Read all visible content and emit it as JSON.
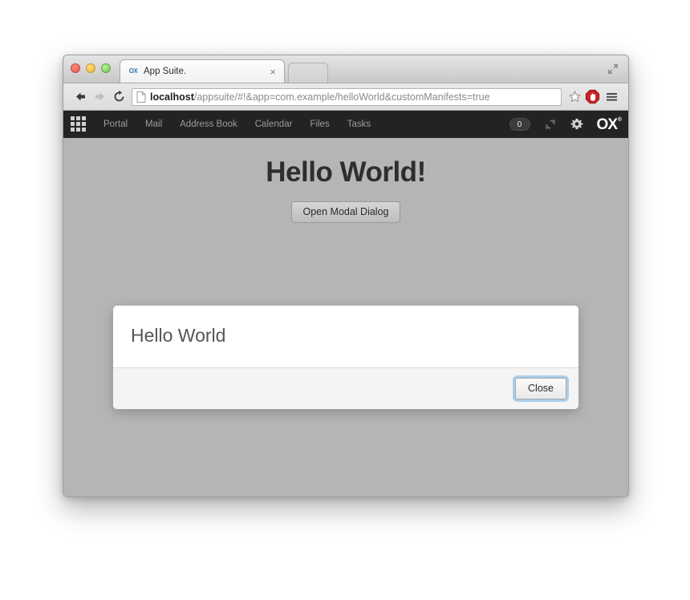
{
  "browser": {
    "traffic_lights": [
      "close",
      "minimize",
      "zoom"
    ],
    "tab": {
      "favicon_label": "OX",
      "title": "App Suite.",
      "close_label": "×"
    },
    "fullscreen_icon": "fullscreen-icon",
    "toolbar": {
      "back_icon": "back-arrow-icon",
      "forward_icon": "forward-arrow-icon",
      "reload_icon": "reload-icon",
      "page_icon": "page-document-icon",
      "url_host": "localhost",
      "url_path": "/appsuite/#!&app=com.example/helloWorld&customManifests=true",
      "url_full": "localhost/appsuite/#!&app=com.example/helloWorld&customManifests=true",
      "star_icon": "bookmark-star-icon",
      "extension_icon": "adblock-extension-icon",
      "menu_icon": "hamburger-menu-icon"
    }
  },
  "ox_topbar": {
    "launcher_icon": "app-launcher-grid-icon",
    "nav_items": [
      {
        "label": "Portal"
      },
      {
        "label": "Mail"
      },
      {
        "label": "Address Book"
      },
      {
        "label": "Calendar"
      },
      {
        "label": "Files"
      },
      {
        "label": "Tasks"
      }
    ],
    "notification_count": "0",
    "refresh_icon": "refresh-icon",
    "settings_icon": "gear-icon",
    "logo_text": "OX",
    "logo_mark": "®"
  },
  "app": {
    "heading": "Hello World!",
    "open_modal_label": "Open Modal Dialog"
  },
  "modal": {
    "title": "Hello World",
    "close_label": "Close"
  },
  "colors": {
    "page_background": "#b5b5b5",
    "topbar_background": "#232323",
    "modal_background": "#ffffff",
    "modal_footer": "#f4f4f4",
    "focus_ring": "#6eafe1",
    "accent_red": "#cc2222"
  }
}
